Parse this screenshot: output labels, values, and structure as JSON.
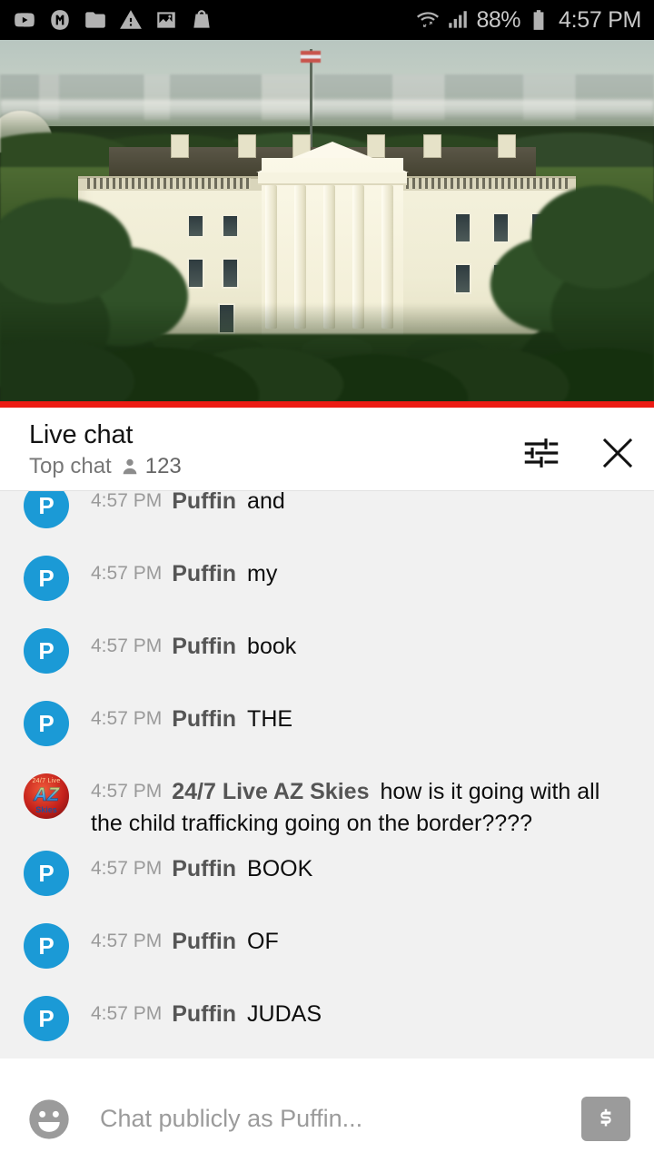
{
  "status_bar": {
    "icons": [
      "youtube-icon",
      "m-app-icon",
      "folder-icon",
      "warning-icon",
      "photo-icon",
      "shopping-bag-icon"
    ],
    "wifi_icon": "wifi-icon",
    "signal_icon": "cell-signal-icon",
    "battery_percent": "88%",
    "battery_icon": "battery-icon",
    "time": "4:57 PM"
  },
  "video": {
    "scene": "white-house-live-stream",
    "progress_color": "#ec1b13",
    "progress_percent": 100
  },
  "chat_header": {
    "title": "Live chat",
    "mode": "Top chat",
    "viewer_icon": "person-icon",
    "viewer_count": "123",
    "settings_icon": "tune-icon",
    "close_icon": "close-icon"
  },
  "messages": [
    {
      "avatar": "puffin",
      "initial": "P",
      "time": "4:57 PM",
      "author": "Puffin",
      "text": "and"
    },
    {
      "avatar": "puffin",
      "initial": "P",
      "time": "4:57 PM",
      "author": "Puffin",
      "text": "my"
    },
    {
      "avatar": "puffin",
      "initial": "P",
      "time": "4:57 PM",
      "author": "Puffin",
      "text": "book"
    },
    {
      "avatar": "puffin",
      "initial": "P",
      "time": "4:57 PM",
      "author": "Puffin",
      "text": "THE"
    },
    {
      "avatar": "azskies",
      "initial": "AZ",
      "time": "4:57 PM",
      "author": "24/7 Live AZ Skies",
      "text": "how is it going with all the child trafficking going on the border????"
    },
    {
      "avatar": "puffin",
      "initial": "P",
      "time": "4:57 PM",
      "author": "Puffin",
      "text": "BOOK"
    },
    {
      "avatar": "puffin",
      "initial": "P",
      "time": "4:57 PM",
      "author": "Puffin",
      "text": "OF"
    },
    {
      "avatar": "puffin",
      "initial": "P",
      "time": "4:57 PM",
      "author": "Puffin",
      "text": "JUDAS"
    }
  ],
  "az_avatar": {
    "top_text": "24/7 Live",
    "main_text": "AZ",
    "bottom_text": "Skies"
  },
  "composer": {
    "emoji_icon": "emoji-smiley-icon",
    "placeholder": "Chat publicly as Puffin...",
    "value": "",
    "superchat_icon": "dollar-icon"
  },
  "colors": {
    "accent_red": "#ec1b13",
    "avatar_blue": "#1b9ad6",
    "chat_bg": "#f1f1f1"
  }
}
